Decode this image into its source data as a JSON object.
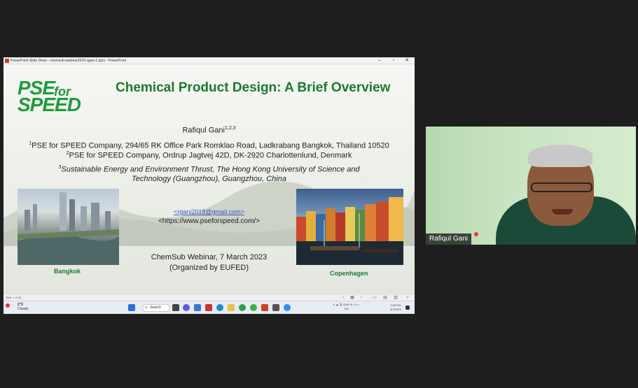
{
  "window": {
    "title": "PowerPoint Slide Show - chemsub-webinar2023-rgani-1.pptx - PowerPoint",
    "minimize": "–",
    "restore": "▫",
    "close": "✕"
  },
  "slide": {
    "logo_pse": "PSE",
    "logo_for": "for",
    "logo_speed": "SPEED",
    "title": "Chemical Product Design: A Brief Overview",
    "author": "Rafiqul Gani",
    "author_sup": "1,2,3",
    "aff1_sup": "1",
    "aff1_bold": "PSE for SPEED Company,",
    "aff1_rest": " 294/65 RK Office Park Romklao Road, Ladkrabang Bangkok, Thailand 10520",
    "aff2_sup": "2",
    "aff2": "PSE for SPEED Company, Ordrup Jagtvej 42D, DK-2920 Charlottenlund, Denmark",
    "aff3_sup": "3",
    "aff3_line1": "Sustainable Energy and Environment Thrust, The Hong Kong University of Science and",
    "aff3_line2": "Technology (Guangzhou), Guangzhou, China",
    "email": "<rgani2018@gmail.com>",
    "website": "<https://www.pseforspeed.com/>",
    "webinar": "ChemSub Webinar, 7 March 2023",
    "organized": "(Organized by EUFED)",
    "caption_left": "Bangkok",
    "caption_right": "Copenhagen"
  },
  "statusbar": {
    "slide_number": "Slide 1 of 20"
  },
  "taskbar": {
    "weather_temp": "2°C",
    "weather_desc": "Cloudy",
    "search_label": "Search",
    "lang_line1": "ENG",
    "lang_line2": "DA",
    "time": "2:05 PM",
    "date": "3/7/2023"
  },
  "video": {
    "participant_name": "Rafiqul Gani"
  },
  "colors": {
    "brand_green": "#1f9b3b",
    "title_green": "#1c7a2c",
    "link_blue": "#3557c9"
  }
}
